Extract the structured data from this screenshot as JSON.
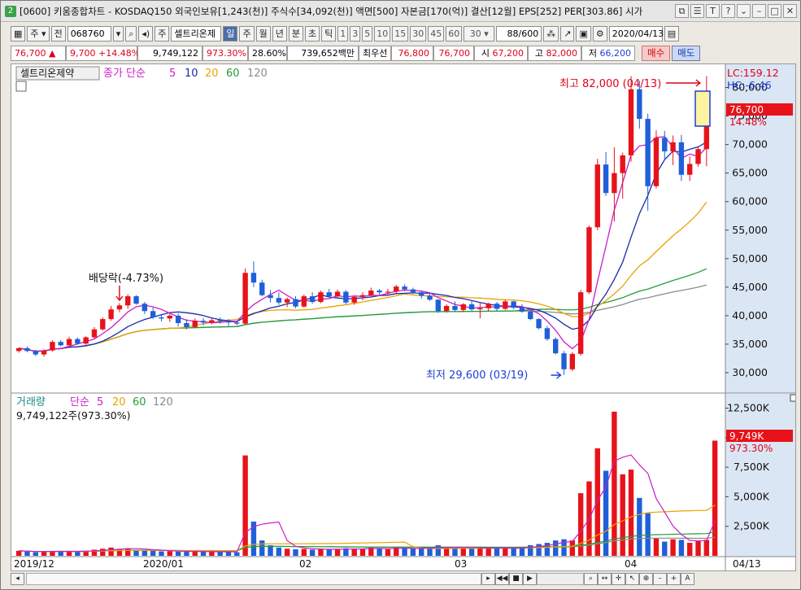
{
  "window": {
    "app_icon": "2",
    "title": "[0600] 키움종합차트 - KOSDAQ150 외국인보유[1,243(천)] 주식수[34,092(천)] 액면[500] 자본금[170(억)] 결산[12월] EPS[252] PER[303.86] 시가"
  },
  "toolbar": {
    "period_select": "주",
    "prev_label": "전",
    "stock_code": "068760",
    "stock_name": "셀트리온제",
    "stock_tag": "주",
    "period_tabs": [
      "일",
      "주",
      "월",
      "년",
      "분",
      "초",
      "틱"
    ],
    "num_tabs": [
      "1",
      "3",
      "5",
      "10",
      "15",
      "30",
      "45",
      "60"
    ],
    "minute_value": "30",
    "bar_count": "88/600",
    "date": "2020/04/13"
  },
  "quote": {
    "price": "76,700",
    "arrow": "▲",
    "change": "9,700",
    "change_pct": "+14.48%",
    "volume": "9,749,122",
    "volume_pct": "973.30%",
    "turnover": "28.60%",
    "amount": "739,652백만",
    "label_best": "최우선",
    "best_ask": "76,800",
    "best_bid": "76,700",
    "open_label": "시",
    "open": "67,200",
    "high_label": "고",
    "high": "82,000",
    "low_label": "저",
    "low": "66,200",
    "buy_label": "매수",
    "sell_label": "매도"
  },
  "chart_data": {
    "type": "candlestick",
    "stock_label": "셀트리온제약",
    "price_legend": [
      "종가 단순",
      "5",
      "10",
      "20",
      "60",
      "120"
    ],
    "volume_legend": [
      "거래량",
      "단순",
      "5",
      "20",
      "60",
      "120"
    ],
    "volume_readout": "9,749,122주(973.30%)",
    "lc": "LC:159.12",
    "hc": "HC:-6.46",
    "current_price_tag": "76,700",
    "current_pct_tag": "14.48%",
    "current_volume_tag": "9,749K",
    "current_volume_pct_tag": "973.30%",
    "annotation_high": "최고 82,000 (04/13)",
    "annotation_low": "최저 29,600 (03/19)",
    "annotation_dividend": "배당락(-4.73%)",
    "price_axis": [
      "80,000",
      "75,000",
      "70,000",
      "65,000",
      "60,000",
      "55,000",
      "50,000",
      "45,000",
      "40,000",
      "35,000",
      "30,000"
    ],
    "volume_axis": [
      "12,500K",
      "10,000K",
      "7,500K",
      "5,000K",
      "2,500K"
    ],
    "x_labels": [
      "2019/12",
      "2020/01",
      "02",
      "03",
      "04"
    ],
    "x_end_label": "04/13",
    "price_ylim": [
      27000,
      83500
    ],
    "volume_ylim": [
      0,
      13500
    ],
    "colors": {
      "up": "#e8131a",
      "down": "#1f5fd9",
      "ma5": "#c81ec8",
      "ma10": "#1a2aa8",
      "ma20": "#e8a300",
      "ma60": "#229e3a",
      "ma120": "#8c8c8c"
    },
    "candles": [
      [
        33800,
        34400,
        33500,
        34300
      ],
      [
        34300,
        34600,
        33600,
        33800
      ],
      [
        33800,
        34000,
        32900,
        33200
      ],
      [
        33200,
        34100,
        32800,
        33900
      ],
      [
        33900,
        35700,
        33700,
        35400
      ],
      [
        35400,
        35700,
        34600,
        34800
      ],
      [
        34800,
        36300,
        34700,
        35900
      ],
      [
        35900,
        36200,
        34900,
        35100
      ],
      [
        35100,
        36400,
        34900,
        36200
      ],
      [
        36200,
        38000,
        36000,
        37600
      ],
      [
        37600,
        39700,
        37400,
        39400
      ],
      [
        39400,
        41700,
        39100,
        41100
      ],
      [
        41100,
        42200,
        40600,
        41800
      ],
      [
        41800,
        43800,
        41200,
        43400
      ],
      [
        43400,
        43600,
        41900,
        42100
      ],
      [
        42100,
        42400,
        40300,
        40800
      ],
      [
        40800,
        41400,
        39400,
        39700
      ],
      [
        39700,
        40100,
        39000,
        39500
      ],
      [
        39500,
        40300,
        38900,
        40000
      ],
      [
        40000,
        40400,
        38100,
        38700
      ],
      [
        38700,
        39400,
        37600,
        38000
      ],
      [
        38000,
        39500,
        37800,
        39100
      ],
      [
        39100,
        39600,
        38300,
        38800
      ],
      [
        38800,
        39500,
        38500,
        39200
      ],
      [
        39200,
        39700,
        38600,
        39000
      ],
      [
        39000,
        39400,
        38200,
        38800
      ],
      [
        38800,
        39200,
        38300,
        38600
      ],
      [
        38600,
        48300,
        38400,
        47500
      ],
      [
        47500,
        49500,
        45000,
        45800
      ],
      [
        45800,
        46300,
        43400,
        43600
      ],
      [
        43600,
        44500,
        42300,
        43100
      ],
      [
        43100,
        44100,
        41900,
        42300
      ],
      [
        42300,
        43200,
        41500,
        42900
      ],
      [
        42900,
        43400,
        41300,
        41600
      ],
      [
        41600,
        43700,
        41400,
        43400
      ],
      [
        43400,
        44100,
        42100,
        42400
      ],
      [
        42400,
        44400,
        42200,
        44100
      ],
      [
        44100,
        44700,
        43300,
        43400
      ],
      [
        43400,
        44600,
        43100,
        44200
      ],
      [
        44200,
        44500,
        42000,
        42300
      ],
      [
        42300,
        43500,
        41900,
        43300
      ],
      [
        43300,
        44100,
        42700,
        43600
      ],
      [
        43600,
        44900,
        43200,
        44400
      ],
      [
        44400,
        44700,
        43600,
        44100
      ],
      [
        44100,
        44700,
        43500,
        44200
      ],
      [
        44200,
        45400,
        43900,
        45100
      ],
      [
        45100,
        45500,
        44300,
        44600
      ],
      [
        44600,
        44900,
        43800,
        44100
      ],
      [
        44100,
        44400,
        43000,
        43500
      ],
      [
        43500,
        43900,
        42600,
        42800
      ],
      [
        42800,
        42900,
        40500,
        40800
      ],
      [
        40800,
        42000,
        40500,
        41700
      ],
      [
        41700,
        42500,
        40700,
        41000
      ],
      [
        41000,
        42200,
        40600,
        42000
      ],
      [
        42000,
        42700,
        40800,
        41100
      ],
      [
        41100,
        42300,
        39500,
        41300
      ],
      [
        41300,
        42300,
        40700,
        42100
      ],
      [
        42100,
        42400,
        40800,
        41200
      ],
      [
        41200,
        42800,
        41000,
        42500
      ],
      [
        42500,
        42600,
        41100,
        41400
      ],
      [
        41400,
        42000,
        40500,
        40700
      ],
      [
        40700,
        40900,
        39200,
        39400
      ],
      [
        39400,
        39600,
        37600,
        37800
      ],
      [
        37800,
        38200,
        35600,
        35900
      ],
      [
        35900,
        36200,
        33200,
        33400
      ],
      [
        33400,
        33800,
        29600,
        30600
      ],
      [
        30600,
        33600,
        30300,
        33300
      ],
      [
        33300,
        44500,
        33000,
        44100
      ],
      [
        44100,
        55800,
        43800,
        55500
      ],
      [
        55500,
        67500,
        55000,
        66500
      ],
      [
        66500,
        68700,
        61000,
        61500
      ],
      [
        61500,
        69500,
        56500,
        65000
      ],
      [
        65000,
        68600,
        60500,
        68100
      ],
      [
        68100,
        82000,
        67000,
        79700
      ],
      [
        79700,
        81200,
        72800,
        74500
      ],
      [
        74500,
        75400,
        58400,
        62700
      ],
      [
        62700,
        72500,
        62300,
        71200
      ],
      [
        71200,
        72400,
        67200,
        68800
      ],
      [
        68800,
        71600,
        66400,
        70400
      ],
      [
        70400,
        71700,
        63600,
        64700
      ],
      [
        64700,
        67900,
        63600,
        66600
      ],
      [
        66600,
        69700,
        66100,
        69200
      ],
      [
        69200,
        82000,
        66200,
        76700
      ]
    ],
    "volumes": [
      [
        420,
        0
      ],
      [
        380,
        1
      ],
      [
        300,
        1
      ],
      [
        350,
        0
      ],
      [
        420,
        0
      ],
      [
        400,
        1
      ],
      [
        380,
        0
      ],
      [
        350,
        1
      ],
      [
        430,
        0
      ],
      [
        520,
        0
      ],
      [
        600,
        0
      ],
      [
        700,
        0
      ],
      [
        580,
        0
      ],
      [
        640,
        0
      ],
      [
        500,
        1
      ],
      [
        460,
        1
      ],
      [
        420,
        1
      ],
      [
        380,
        1
      ],
      [
        390,
        0
      ],
      [
        360,
        1
      ],
      [
        340,
        1
      ],
      [
        380,
        0
      ],
      [
        350,
        1
      ],
      [
        320,
        0
      ],
      [
        330,
        1
      ],
      [
        350,
        1
      ],
      [
        300,
        1
      ],
      [
        8500,
        0
      ],
      [
        2900,
        1
      ],
      [
        1300,
        1
      ],
      [
        900,
        1
      ],
      [
        700,
        1
      ],
      [
        600,
        0
      ],
      [
        550,
        1
      ],
      [
        580,
        0
      ],
      [
        520,
        1
      ],
      [
        600,
        0
      ],
      [
        520,
        1
      ],
      [
        560,
        0
      ],
      [
        640,
        1
      ],
      [
        580,
        0
      ],
      [
        620,
        0
      ],
      [
        700,
        0
      ],
      [
        600,
        1
      ],
      [
        560,
        0
      ],
      [
        720,
        0
      ],
      [
        650,
        1
      ],
      [
        600,
        1
      ],
      [
        640,
        1
      ],
      [
        620,
        1
      ],
      [
        900,
        1
      ],
      [
        700,
        0
      ],
      [
        680,
        1
      ],
      [
        620,
        0
      ],
      [
        650,
        1
      ],
      [
        700,
        0
      ],
      [
        640,
        0
      ],
      [
        620,
        1
      ],
      [
        680,
        0
      ],
      [
        640,
        1
      ],
      [
        700,
        1
      ],
      [
        900,
        1
      ],
      [
        1000,
        1
      ],
      [
        1100,
        1
      ],
      [
        1300,
        1
      ],
      [
        1400,
        1
      ],
      [
        1300,
        0
      ],
      [
        5300,
        0
      ],
      [
        6300,
        0
      ],
      [
        9100,
        0
      ],
      [
        7200,
        1
      ],
      [
        12200,
        0
      ],
      [
        6900,
        0
      ],
      [
        7300,
        0
      ],
      [
        4900,
        1
      ],
      [
        3600,
        1
      ],
      [
        1500,
        0
      ],
      [
        1200,
        1
      ],
      [
        1400,
        0
      ],
      [
        1350,
        1
      ],
      [
        1100,
        0
      ],
      [
        1250,
        0
      ],
      [
        1350,
        0
      ],
      [
        9749,
        0
      ]
    ]
  }
}
